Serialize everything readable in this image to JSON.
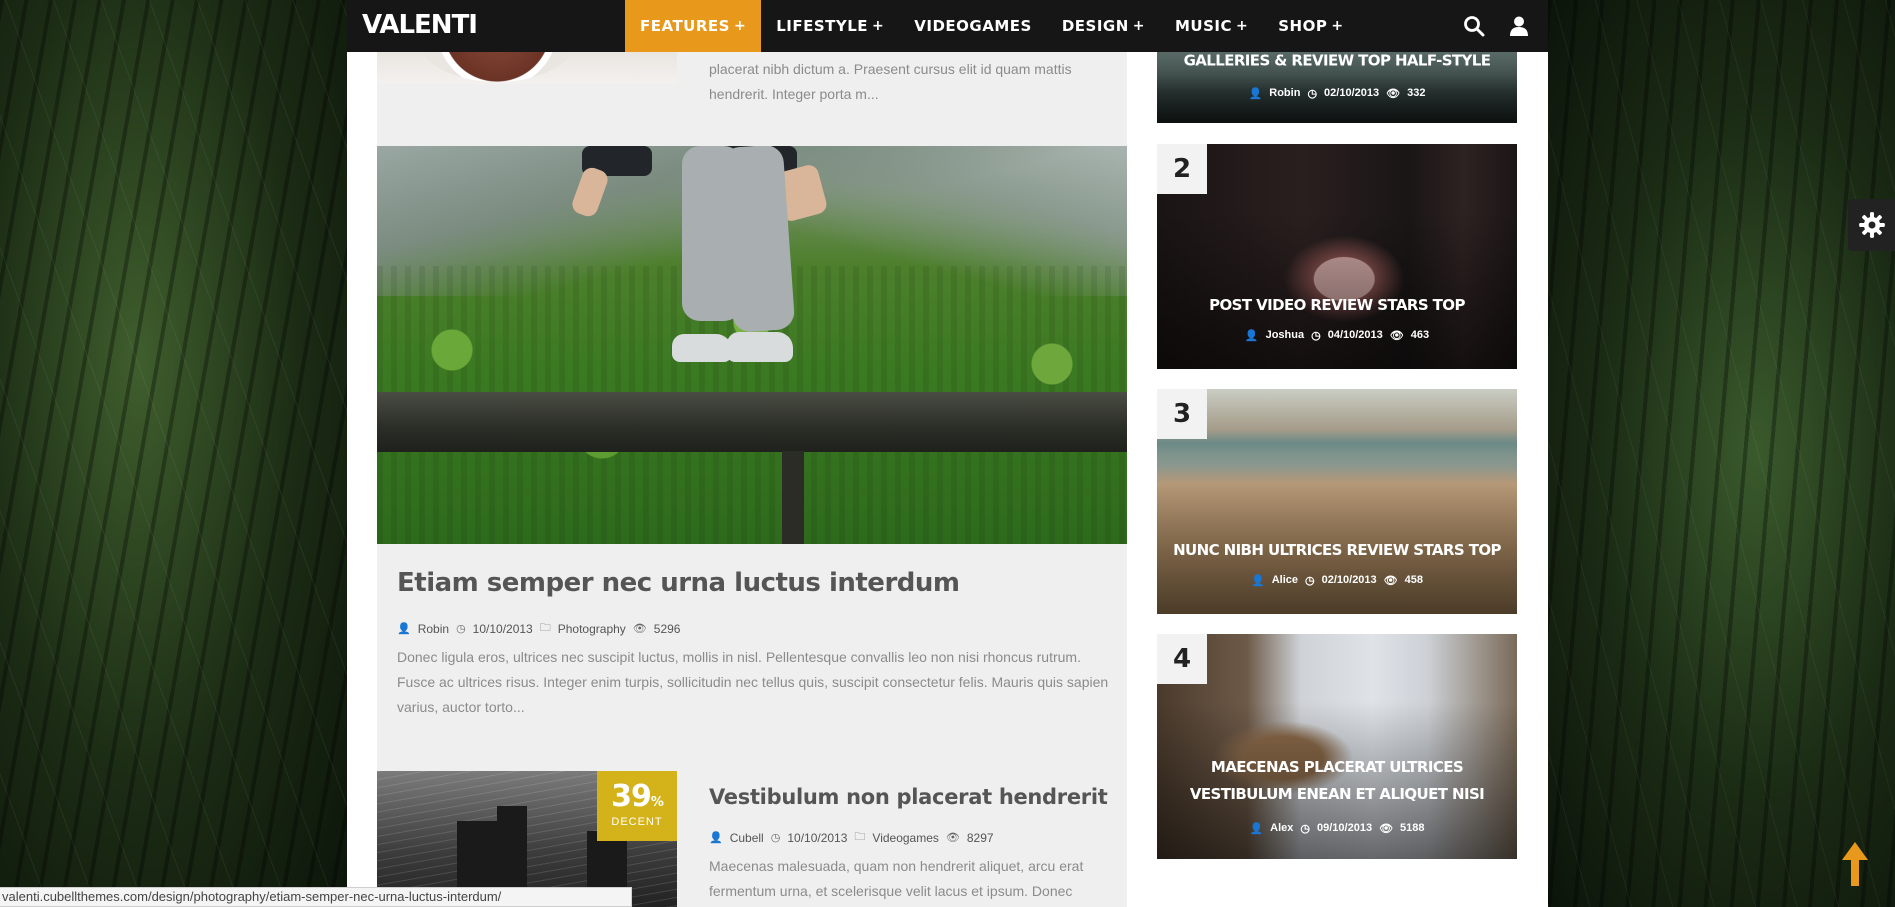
{
  "header": {
    "logo": "VALENTI",
    "nav": [
      {
        "label": "FEATURES",
        "plus": "+"
      },
      {
        "label": "LIFESTYLE",
        "plus": "+"
      },
      {
        "label": "VIDEOGAMES",
        "plus": ""
      },
      {
        "label": "DESIGN",
        "plus": "+"
      },
      {
        "label": "MUSIC",
        "plus": "+"
      },
      {
        "label": "SHOP",
        "plus": "+"
      }
    ],
    "active_nav": "FEATURES",
    "icons": [
      "search-icon",
      "user-icon"
    ]
  },
  "main": {
    "prev_excerpt": "placerat nibh dictum a. Praesent cursus elit id quam mattis hendrerit. Integer porta m...",
    "featured": {
      "title": "Etiam semper nec urna luctus interdum",
      "author": "Robin",
      "date": "10/10/2013",
      "category": "Photography",
      "views": "5296",
      "excerpt": "Donec ligula eros, ultrices nec suscipit luctus, mollis in nisl. Pellentesque convallis leo non nisi rhoncus rutrum. Fusce ac ultrices risus. Integer enim turpis, sollicitudin nec tellus quis, suscipit consectetur felis. Mauris quis sapien varius, auctor torto..."
    },
    "second": {
      "score": "39",
      "score_unit": "%",
      "score_label": "DECENT",
      "title": "Vestibulum non placerat hendrerit",
      "author": "Cubell",
      "date": "10/10/2013",
      "category": "Videogames",
      "views": "8297",
      "excerpt": "Maecenas malesuada, quam non hendrerit aliquet, arcu erat fermentum urna, et scelerisque velit lacus et ipsum. Donec"
    }
  },
  "sidebar": {
    "cards": [
      {
        "rank": "",
        "title": "GALLERIES & REVIEW TOP HALF-STYLE",
        "author": "Robin",
        "date": "02/10/2013",
        "views": "332"
      },
      {
        "rank": "2",
        "title": "POST VIDEO REVIEW STARS TOP",
        "author": "Joshua",
        "date": "04/10/2013",
        "views": "463"
      },
      {
        "rank": "3",
        "title": "NUNC NIBH ULTRICES REVIEW STARS TOP",
        "author": "Alice",
        "date": "02/10/2013",
        "views": "458"
      },
      {
        "rank": "4",
        "title": "MAECENAS PLACERAT ULTRICES VESTIBULUM ENEAN ET ALIQUET NISI",
        "author": "Alex",
        "date": "09/10/2013",
        "views": "5188"
      }
    ]
  },
  "status_url": "valenti.cubellthemes.com/design/photography/etiam-semper-nec-urna-luctus-interdum/",
  "colors": {
    "accent": "#e8991c",
    "score": "#d4b21a",
    "topbar": "#161616"
  }
}
